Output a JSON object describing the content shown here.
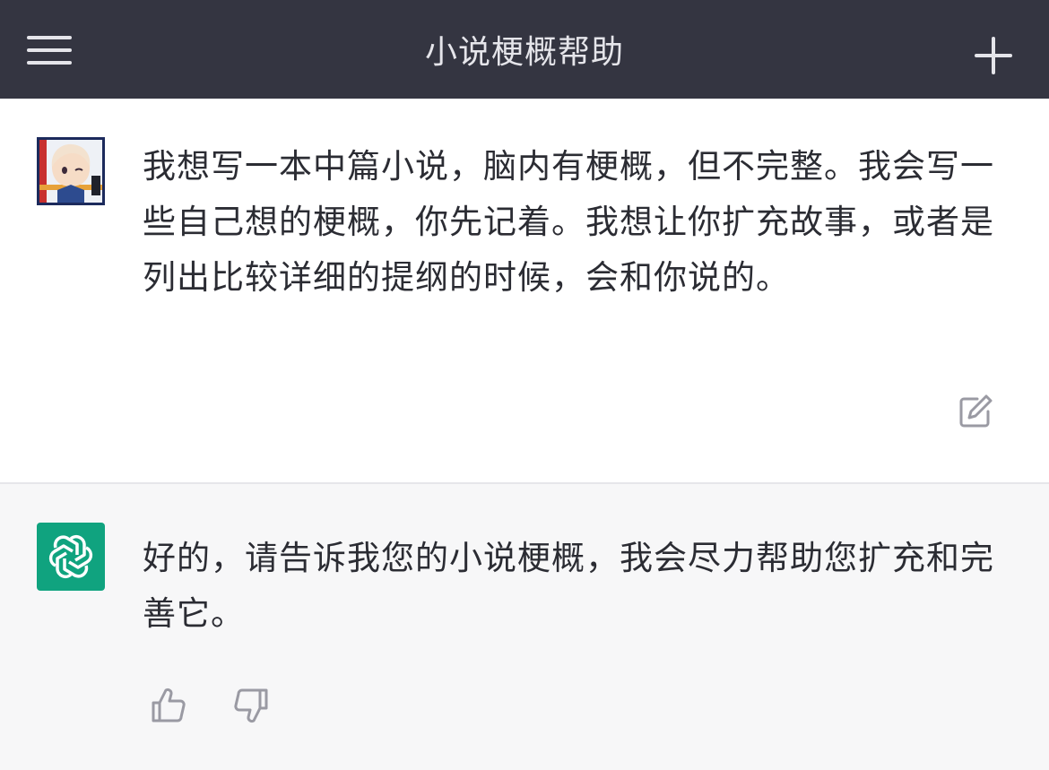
{
  "header": {
    "title": "小说梗概帮助",
    "menu_icon": "hamburger-menu-icon",
    "new_icon": "plus-icon"
  },
  "conversation": [
    {
      "role": "user",
      "avatar": "anime-avatar",
      "text": "我想写一本中篇小说，脑内有梗概，但不完整。我会写一些自己想的梗概，你先记着。我想让你扩充故事，或者是列出比较详细的提纲的时候，会和你说的。",
      "actions": [
        "edit-icon"
      ]
    },
    {
      "role": "assistant",
      "avatar": "openai-logo",
      "text": "好的，请告诉我您的小说梗概，我会尽力帮助您扩充和完善它。",
      "actions": [
        "thumbs-up-icon",
        "thumbs-down-icon"
      ]
    }
  ],
  "colors": {
    "header_bg": "#343541",
    "assistant_bg": "#f7f7f8",
    "user_bg": "#ffffff",
    "accent": "#10a37f"
  }
}
